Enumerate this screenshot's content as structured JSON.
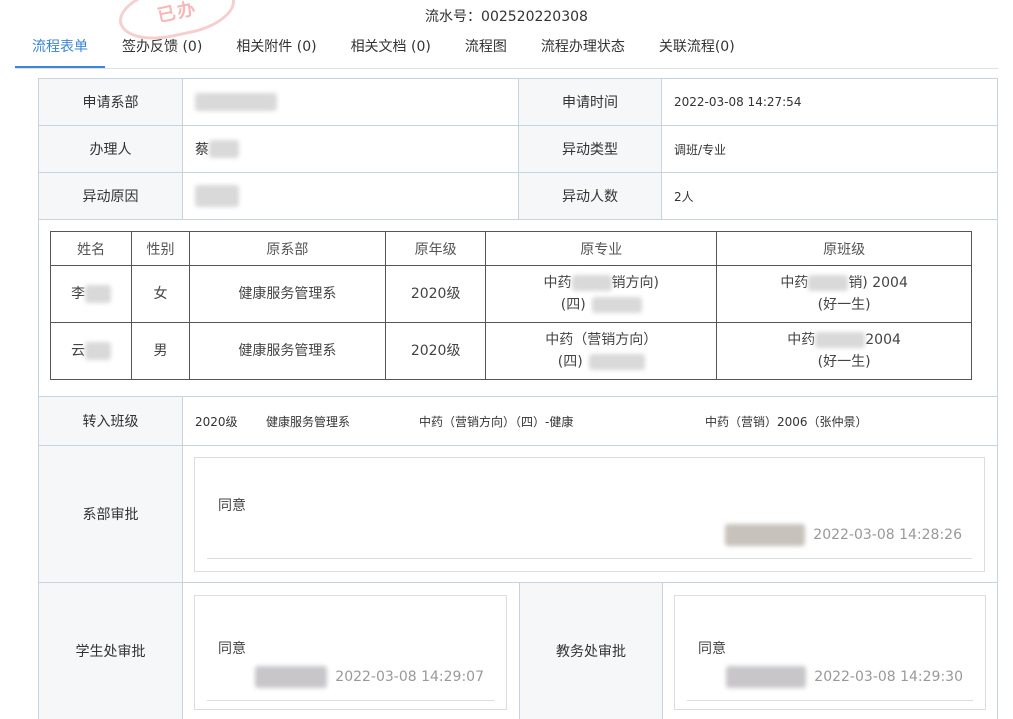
{
  "header": {
    "stamp_text": "已办",
    "serial_label": "流水号：",
    "serial_number": "002520220308"
  },
  "tabs": [
    {
      "label": "流程表单",
      "active": true
    },
    {
      "label": "签办反馈 (0)"
    },
    {
      "label": "相关附件 (0)"
    },
    {
      "label": "相关文档 (0)"
    },
    {
      "label": "流程图"
    },
    {
      "label": "流程办理状态"
    },
    {
      "label": "关联流程(0)"
    }
  ],
  "form": {
    "dept_label": "申请系部",
    "time_label": "申请时间",
    "time_value": "2022-03-08 14:27:54",
    "handler_label": "办理人",
    "handler_value": "蔡",
    "type_label": "异动类型",
    "type_value": "调班/专业",
    "reason_label": "异动原因",
    "count_label": "异动人数",
    "count_value": "2人"
  },
  "students": {
    "headers": [
      "姓名",
      "性别",
      "原系部",
      "原年级",
      "原专业",
      "原班级"
    ],
    "rows": [
      {
        "name": "李",
        "gender": "女",
        "dept": "健康服务管理系",
        "grade": "2020级",
        "major_a": "中药",
        "major_b": "销方向)",
        "major_c": "(四)",
        "class_a": "中药",
        "class_b": "销) 2004",
        "class_c": "(好一生)"
      },
      {
        "name": "云",
        "gender": "男",
        "dept": "健康服务管理系",
        "grade": "2020级",
        "major_a": "中药（营销方向）",
        "major_b": "",
        "major_c": "(四)",
        "class_a": "中药",
        "class_b": "2004",
        "class_c": "(好一生)"
      }
    ]
  },
  "transfer": {
    "label": "转入班级",
    "grade": "2020级",
    "dept": "健康服务管理系",
    "major": "中药（营销方向）（四）-健康",
    "class": "中药（营销）2006（张仲景）"
  },
  "approvals": {
    "dept": {
      "label": "系部审批",
      "opinion": "同意",
      "time": "2022-03-08 14:28:26"
    },
    "student_office": {
      "label": "学生处审批",
      "opinion": "同意",
      "time": "2022-03-08 14:29:07"
    },
    "academic_office": {
      "label": "教务处审批",
      "opinion": "同意",
      "time": "2022-03-08 14:29:30"
    }
  },
  "colors": {
    "accent": "#3a86d9",
    "border": "#c8d3dc",
    "label_bg": "#f5f7f9"
  }
}
